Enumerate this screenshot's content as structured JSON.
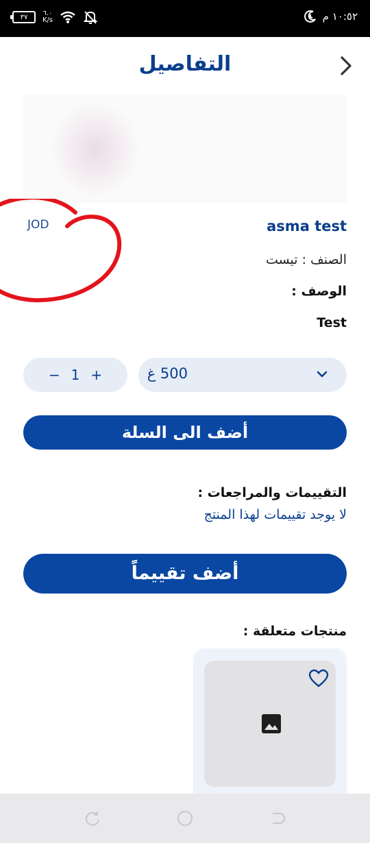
{
  "status_bar": {
    "battery": "٣٧",
    "net_speed_value": "٦.٠",
    "net_speed_unit": "K/s",
    "time": "١٠:٥٢ م"
  },
  "header": {
    "title": "التفاصيل"
  },
  "product": {
    "currency": "JOD",
    "name": "asma test",
    "category_line": "الصنف : تيست",
    "description_label": "الوصف :",
    "description_value": "Test"
  },
  "options": {
    "quantity": "1",
    "plus": "+",
    "minus": "−",
    "weight": "500 غ"
  },
  "actions": {
    "add_to_cart": "أضف الى السلة",
    "add_review": "أضف تقييماً"
  },
  "reviews": {
    "label": "التقييمات والمراجعات :",
    "empty_message": "لا يوجد تقييمات لهذا المنتج"
  },
  "related": {
    "label": "منتجات متعلقة :"
  },
  "colors": {
    "primary": "#0a47a3",
    "title": "#0b3e8e",
    "pill_bg": "#e6edf6",
    "annotation_red": "#e3141b"
  },
  "icons": [
    "back-chevron-icon",
    "chevron-down-icon",
    "heart-icon",
    "image-placeholder-icon",
    "wifi-icon",
    "bell-off-icon",
    "dnd-moon-icon",
    "nav-back-icon",
    "nav-home-icon",
    "nav-recents-icon"
  ]
}
